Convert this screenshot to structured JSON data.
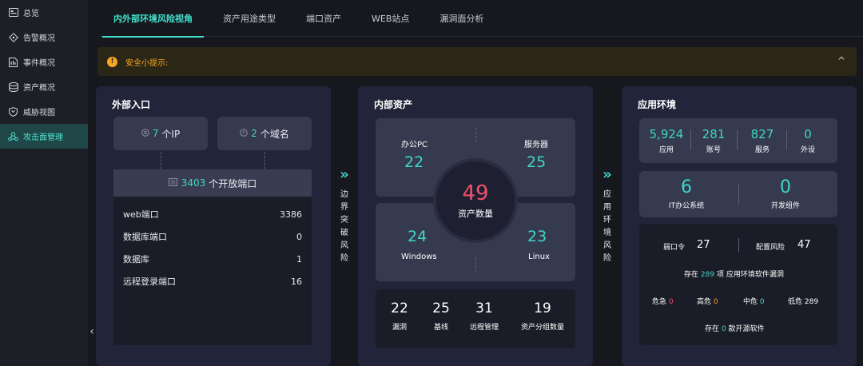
{
  "sidebar": {
    "items": [
      {
        "label": "总览",
        "icon": "overview-icon",
        "active": false
      },
      {
        "label": "告警概况",
        "icon": "alert-diamond-icon",
        "active": false
      },
      {
        "label": "事件概况",
        "icon": "event-doc-icon",
        "active": false
      },
      {
        "label": "资产概况",
        "icon": "database-icon",
        "active": false
      },
      {
        "label": "威胁视图",
        "icon": "shield-icon",
        "active": false
      },
      {
        "label": "攻击面管理",
        "icon": "attack-surface-icon",
        "active": true
      }
    ],
    "collapse_icon": "‹"
  },
  "tabs": [
    {
      "label": "内外部环境风险视角",
      "active": true
    },
    {
      "label": "资产用途类型",
      "active": false
    },
    {
      "label": "端口资产",
      "active": false
    },
    {
      "label": "WEB站点",
      "active": false
    },
    {
      "label": "漏洞面分析",
      "active": false
    }
  ],
  "tip": {
    "text": "安全小提示:",
    "icon": "!",
    "chevron": "^"
  },
  "external": {
    "title": "外部入口",
    "ip": {
      "num": "7",
      "label": "个IP"
    },
    "domain": {
      "num": "2",
      "label": "个域名"
    },
    "ports": {
      "num": "3403",
      "label": "个开放端口"
    },
    "rows": [
      {
        "name": "web端口",
        "value": "3386"
      },
      {
        "name": "数据库端口",
        "value": "0"
      },
      {
        "name": "数据库",
        "value": "1"
      },
      {
        "name": "远程登录端口",
        "value": "16"
      }
    ]
  },
  "arrow1": {
    "chevrons": "»",
    "chars": [
      "边",
      "界",
      "突",
      "破",
      "风",
      "险"
    ]
  },
  "arrow2": {
    "chevrons": "»",
    "chars": [
      "应",
      "用",
      "环",
      "境",
      "风",
      "险"
    ]
  },
  "internal": {
    "title": "内部资产",
    "pc": {
      "label": "办公PC",
      "value": "22"
    },
    "server": {
      "label": "服务器",
      "value": "25"
    },
    "windows": {
      "label": "Windows",
      "value": "24"
    },
    "linux": {
      "label": "Linux",
      "value": "23"
    },
    "total": {
      "value": "49",
      "label": "资产数量"
    },
    "stats": [
      {
        "value": "22",
        "label": "漏洞"
      },
      {
        "value": "25",
        "label": "基线"
      },
      {
        "value": "31",
        "label": "远程管理"
      },
      {
        "value": "19",
        "label": "资产分组数量"
      }
    ]
  },
  "app_env": {
    "title": "应用环境",
    "top_stats": [
      {
        "value": "5,924",
        "label": "应用"
      },
      {
        "value": "281",
        "label": "账号"
      },
      {
        "value": "827",
        "label": "服务"
      },
      {
        "value": "0",
        "label": "外设"
      }
    ],
    "mid_stats": [
      {
        "value": "6",
        "label": "IT办公系统"
      },
      {
        "value": "0",
        "label": "开发组件"
      }
    ],
    "weak_pwd": {
      "label": "弱口令",
      "value": "27"
    },
    "config_risk": {
      "label": "配置风险",
      "value": "47"
    },
    "vuln_line": {
      "prefix": "存在",
      "value": "289",
      "suffix": "项 应用环境软件漏洞"
    },
    "levels": [
      {
        "label": "危急",
        "value": "0"
      },
      {
        "label": "高危",
        "value": "0"
      },
      {
        "label": "中危",
        "value": "0"
      },
      {
        "label": "低危",
        "value": "289"
      }
    ],
    "oss_line": {
      "prefix": "存在",
      "value": "0",
      "suffix": "款开源软件"
    }
  }
}
